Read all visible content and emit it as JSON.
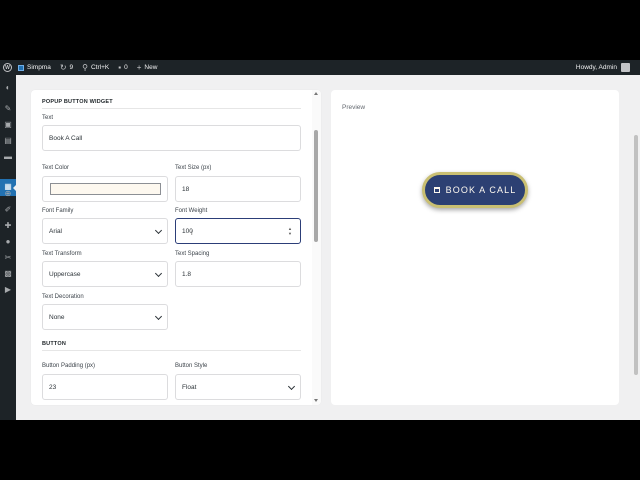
{
  "adminbar": {
    "site_name": "Simpma",
    "updates_count": "9",
    "search_shortcut": "Ctrl+K",
    "comments_count": "0",
    "new_label": "New",
    "howdy": "Howdy, Admin"
  },
  "settings": {
    "section_widget": "POPUP BUTTON WIDGET",
    "text_label": "Text",
    "text_value": "Book A Call",
    "text_color_label": "Text Color",
    "text_color_value": "#fdf8ef",
    "text_size_label": "Text Size (px)",
    "text_size_value": "18",
    "font_family_label": "Font Family",
    "font_family_value": "Arial",
    "font_weight_label": "Font Weight",
    "font_weight_value": "100",
    "text_transform_label": "Text Transform",
    "text_transform_value": "Uppercase",
    "text_spacing_label": "Text Spacing",
    "text_spacing_value": "1.8",
    "text_decoration_label": "Text Decoration",
    "text_decoration_value": "None",
    "section_button": "BUTTON",
    "button_padding_label": "Button Padding (px)",
    "button_padding_value": "23",
    "button_style_label": "Button Style",
    "button_style_value": "Float"
  },
  "preview": {
    "label": "Preview",
    "button_text": "Book A Call",
    "button_bg": "#2c4073",
    "button_border": "#c9bf72"
  },
  "icons": {
    "menu": [
      "dashboard-icon",
      "pin-icon",
      "media-icon",
      "pages-icon",
      "comments-icon",
      "calendar-icon",
      "add-icon",
      "appearance-icon",
      "plugins-icon",
      "users-icon",
      "tools-icon",
      "settings-icon",
      "play-icon"
    ]
  }
}
